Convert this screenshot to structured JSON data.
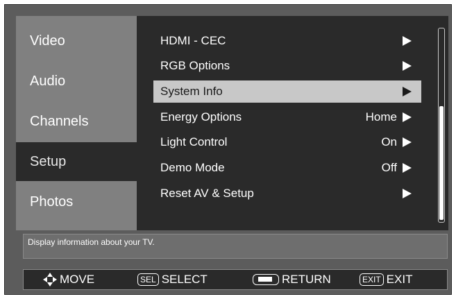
{
  "sidebar": {
    "items": [
      {
        "label": "Video"
      },
      {
        "label": "Audio"
      },
      {
        "label": "Channels"
      },
      {
        "label": "Setup"
      },
      {
        "label": "Photos"
      }
    ],
    "selected": "Setup"
  },
  "menu": {
    "items": [
      {
        "label": "HDMI - CEC",
        "value": ""
      },
      {
        "label": "RGB Options",
        "value": ""
      },
      {
        "label": "System Info",
        "value": ""
      },
      {
        "label": "Energy Options",
        "value": "Home"
      },
      {
        "label": "Light Control",
        "value": "On"
      },
      {
        "label": "Demo Mode",
        "value": "Off"
      },
      {
        "label": "Reset AV & Setup",
        "value": ""
      }
    ],
    "selected": "System Info"
  },
  "description": "Display information about your TV.",
  "footer": {
    "move": "MOVE",
    "sel_key": "SEL",
    "select": "SELECT",
    "return": "RETURN",
    "exit_key": "EXIT",
    "exit": "EXIT"
  },
  "colors": {
    "background": "#5c5c5c",
    "panel": "#2a2a2a",
    "sidebar": "#808080",
    "highlight": "#c8c8c8",
    "text": "#ffffff"
  },
  "icons": [
    "right-arrow-icon",
    "move-icon",
    "return-icon"
  ]
}
